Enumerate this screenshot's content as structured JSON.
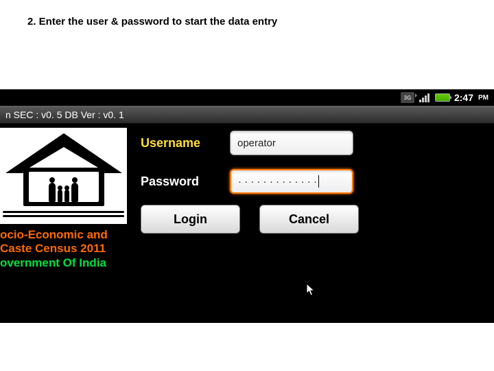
{
  "slide": {
    "caption": "2. Enter the user & password to start the data entry"
  },
  "status": {
    "network": "3G",
    "time": "2:47",
    "ampm": "PM"
  },
  "titlebar": {
    "text": "n   SEC : v0. 5 DB Ver : v0. 1"
  },
  "brand": {
    "line1": "ocio-Economic and Caste Census 2011",
    "line2": "overnment Of India"
  },
  "form": {
    "username_label": "Username",
    "password_label": "Password",
    "username_value": "operator",
    "password_value": "· · · · · · · · · · · · ·",
    "login_label": "Login",
    "cancel_label": "Cancel"
  }
}
